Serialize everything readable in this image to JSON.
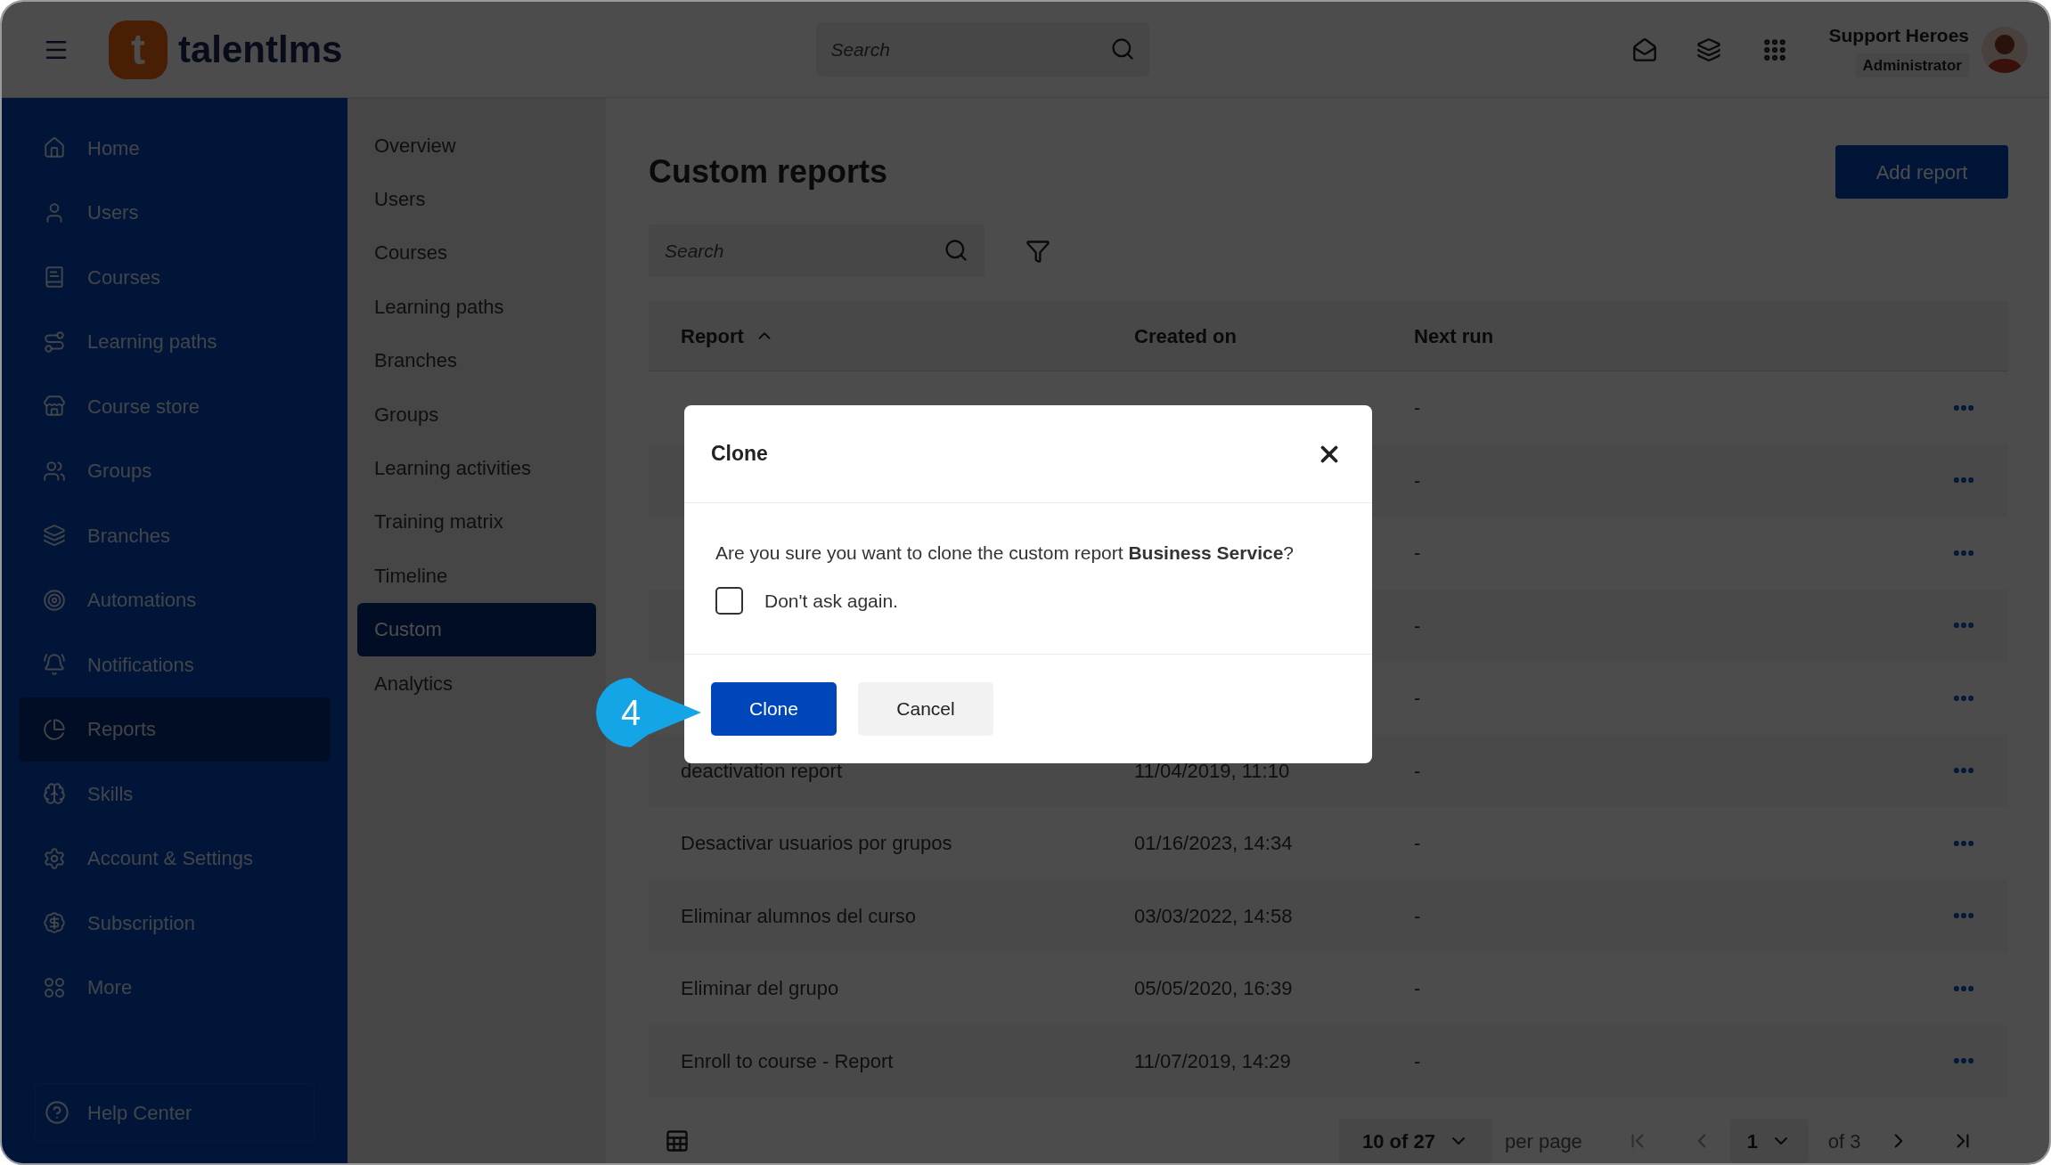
{
  "header": {
    "logo": {
      "mark": "t",
      "name": "talentlms"
    },
    "search": {
      "placeholder": "Search"
    },
    "user": {
      "name": "Support Heroes",
      "role": "Administrator"
    }
  },
  "sidebar": {
    "items": [
      {
        "label": "Home",
        "selected": false
      },
      {
        "label": "Users",
        "selected": false
      },
      {
        "label": "Courses",
        "selected": false
      },
      {
        "label": "Learning paths",
        "selected": false
      },
      {
        "label": "Course store",
        "selected": false
      },
      {
        "label": "Groups",
        "selected": false
      },
      {
        "label": "Branches",
        "selected": false
      },
      {
        "label": "Automations",
        "selected": false
      },
      {
        "label": "Notifications",
        "selected": false
      },
      {
        "label": "Reports",
        "selected": true
      },
      {
        "label": "Skills",
        "selected": false
      },
      {
        "label": "Account & Settings",
        "selected": false
      },
      {
        "label": "Subscription",
        "selected": false
      },
      {
        "label": "More",
        "selected": false
      }
    ],
    "help": "Help Center"
  },
  "subnav": {
    "items": [
      {
        "label": "Overview",
        "selected": false
      },
      {
        "label": "Users",
        "selected": false
      },
      {
        "label": "Courses",
        "selected": false
      },
      {
        "label": "Learning paths",
        "selected": false
      },
      {
        "label": "Branches",
        "selected": false
      },
      {
        "label": "Groups",
        "selected": false
      },
      {
        "label": "Learning activities",
        "selected": false
      },
      {
        "label": "Training matrix",
        "selected": false
      },
      {
        "label": "Timeline",
        "selected": false
      },
      {
        "label": "Custom",
        "selected": true
      },
      {
        "label": "Analytics",
        "selected": false
      }
    ]
  },
  "main": {
    "title": "Custom reports",
    "add_button": "Add report",
    "search": {
      "placeholder": "Search"
    },
    "table": {
      "columns": [
        {
          "label": "Report",
          "sorted_ascending": true
        },
        {
          "label": "Created on"
        },
        {
          "label": "Next run"
        }
      ],
      "rows": [
        {
          "next_run": "-"
        },
        {
          "next_run": "-"
        },
        {
          "next_run": "-"
        },
        {
          "next_run": "-"
        },
        {
          "next_run": "-"
        },
        {
          "report": "deactivation report",
          "created_on": "11/04/2019, 11:10",
          "next_run": "-"
        },
        {
          "report": "Desactivar usuarios por grupos",
          "created_on": "01/16/2023, 14:34",
          "next_run": "-"
        },
        {
          "report": "Eliminar alumnos del curso",
          "created_on": "03/03/2022, 14:58",
          "next_run": "-"
        },
        {
          "report": "Eliminar del grupo",
          "created_on": "05/05/2020, 16:39",
          "next_run": "-"
        },
        {
          "report": "Enroll to course - Report",
          "created_on": "11/07/2019, 14:29",
          "next_run": "-"
        }
      ]
    },
    "pagination": {
      "per_page": "10 of 27",
      "per_page_label": "per page",
      "page": "1",
      "of_pages": "of 3"
    }
  },
  "dialog": {
    "title": "Clone",
    "message": "Are you sure you want to clone the custom report **Business Service**?",
    "checkbox": {
      "label": "Don't ask again.",
      "checked": false
    },
    "buttons": [
      {
        "label": "Clone",
        "kind": "primary"
      },
      {
        "label": "Cancel",
        "kind": "secondary"
      }
    ]
  },
  "step_badge": "4"
}
